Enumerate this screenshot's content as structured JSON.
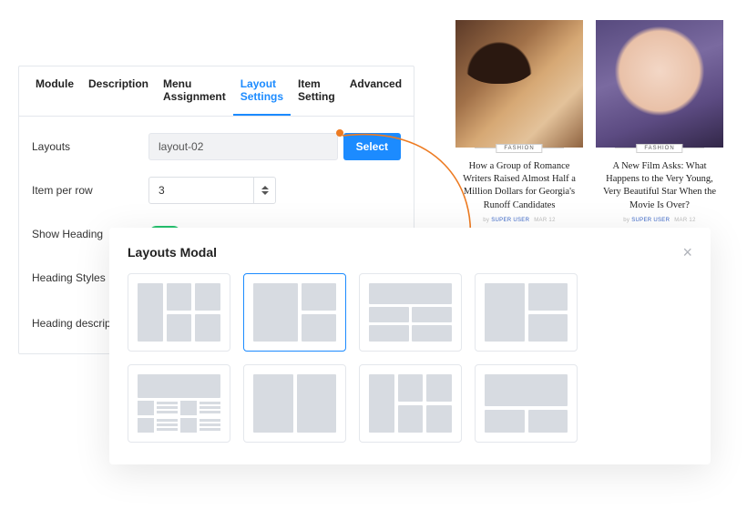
{
  "tabs": [
    "Module",
    "Description",
    "Menu Assignment",
    "Layout Settings",
    "Item Setting",
    "Advanced"
  ],
  "active_tab": 3,
  "form": {
    "layouts_label": "Layouts",
    "layouts_value": "layout-02",
    "select_btn": "Select",
    "item_per_row_label": "Item per row",
    "item_per_row_value": "3",
    "show_heading_label": "Show Heading",
    "heading_styles_label": "Heading Styles",
    "heading_desc_label": "Heading description"
  },
  "modal": {
    "title": "Layouts Modal",
    "selected": 1
  },
  "cards": [
    {
      "badge": "FASHION",
      "title": "How a Group of Romance Writers Raised Almost Half a Million Dollars for Georgia's Runoff Candidates",
      "author": "SUPER USER",
      "date": "MAR 12"
    },
    {
      "badge": "FASHION",
      "title": "A New Film Asks: What Happens to the Very Young, Very Beautiful Star When the Movie Is Over?",
      "author": "SUPER USER",
      "date": "MAR 12"
    }
  ]
}
